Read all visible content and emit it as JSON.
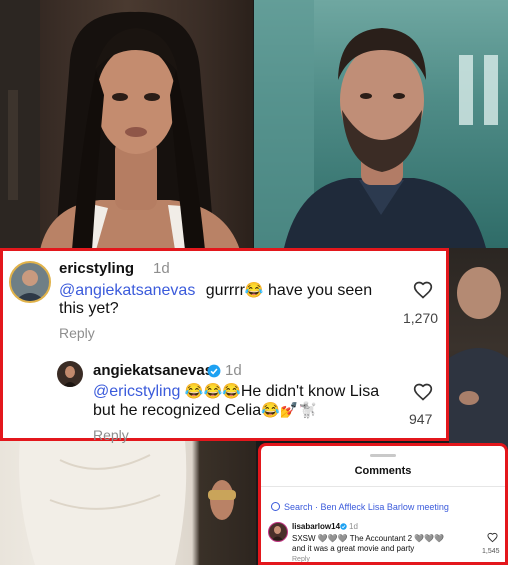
{
  "colors": {
    "highlight_border": "#e3171c",
    "mention": "#3b5bdb",
    "verified": "#1da1f2",
    "muted": "#8e8e8e"
  },
  "comment1": {
    "username": "ericstyling",
    "time": "1d",
    "mention": "@angiekatsanevas",
    "text_a": "gurrrr",
    "emoji_a": "😂",
    "text_b": " have you seen",
    "text_c": "this yet?",
    "reply_label": "Reply",
    "likes": "1,270",
    "heart_icon": "heart-outline"
  },
  "comment2": {
    "username": "angiekatsanevas",
    "time": "1d",
    "verified_icon": "verified-badge",
    "mention": "@ericstyling",
    "emoji_a": "😂😂😂",
    "text_a": "He didn't know Lisa",
    "text_b": "but he recognized Celia",
    "emoji_b": "😂💅🐩",
    "reply_label": "Reply",
    "likes": "947",
    "heart_icon": "heart-outline"
  },
  "sheet": {
    "title": "Comments",
    "search_text": "Search · Ben Affleck Lisa Barlow meeting",
    "comment": {
      "username": "lisabarlow14",
      "time": "1d",
      "text_a": "SXSW",
      "hearts_a": "🩶🩶🩶",
      "text_b": "The Accountant 2",
      "hearts_b": "🩶🩶🩶",
      "text_c": "and it was a great movie and party",
      "reply_label": "Reply",
      "likes": "1,545"
    }
  }
}
